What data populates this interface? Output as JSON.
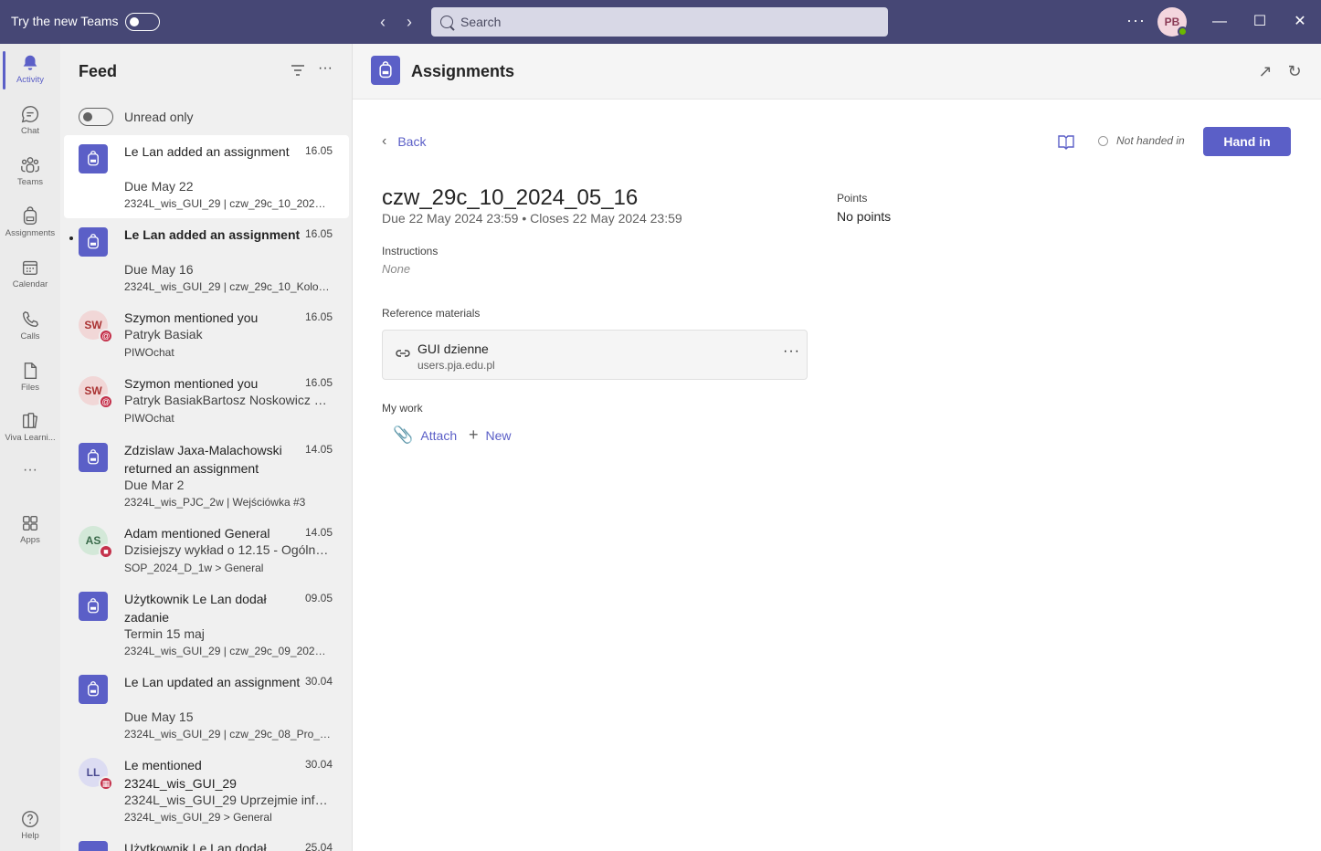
{
  "titlebar": {
    "try_new_teams": "Try the new Teams",
    "search_placeholder": "Search",
    "avatar_initials": "PB",
    "more": "···"
  },
  "rail": {
    "items": [
      {
        "label": "Activity",
        "icon": "bell-icon"
      },
      {
        "label": "Chat",
        "icon": "chat-icon"
      },
      {
        "label": "Teams",
        "icon": "teams-icon"
      },
      {
        "label": "Assignments",
        "icon": "backpack-icon"
      },
      {
        "label": "Calendar",
        "icon": "calendar-icon"
      },
      {
        "label": "Calls",
        "icon": "phone-icon"
      },
      {
        "label": "Files",
        "icon": "file-icon"
      },
      {
        "label": "Viva Learni...",
        "icon": "books-icon"
      },
      {
        "label": "Apps",
        "icon": "apps-icon"
      },
      {
        "label": "Help",
        "icon": "help-icon"
      }
    ],
    "more": "···"
  },
  "feed": {
    "title": "Feed",
    "unread_only": "Unread only",
    "items": [
      {
        "title": "Le Lan added an assignment",
        "date": "16.05",
        "sub": "Due May 22",
        "meta": "2324L_wis_GUI_29 | czw_29c_10_2024_05..."
      },
      {
        "title": "Le Lan added an assignment",
        "date": "16.05",
        "sub": "Due May 16",
        "meta": "2324L_wis_GUI_29 | czw_29c_10_Kolokwi..."
      },
      {
        "title": "Szymon mentioned you",
        "date": "16.05",
        "sub": "Patryk Basiak",
        "meta": "PIWOchat",
        "initials": "SW"
      },
      {
        "title": "Szymon mentioned you",
        "date": "16.05",
        "sub": "Patryk BasiakBartosz Noskowicz m...",
        "meta": "PIWOchat",
        "initials": "SW"
      },
      {
        "title": "Zdzislaw Jaxa-Malachowski returned an assignment",
        "date": "14.05",
        "sub": "Due Mar 2",
        "meta": "2324L_wis_PJC_2w | Wejściówka #3"
      },
      {
        "title": "Adam mentioned General",
        "date": "14.05",
        "sub": "Dzisiejszy wykład o 12.15 - Ogólne...",
        "meta": "SOP_2024_D_1w > General",
        "initials": "AS"
      },
      {
        "title": "Użytkownik Le Lan dodał zadanie",
        "date": "09.05",
        "sub": "Termin 15 maj",
        "meta": "2324L_wis_GUI_29 | czw_29c_09_2024_05..."
      },
      {
        "title": "Le Lan updated an assignment",
        "date": "30.04",
        "sub": "Due May 15",
        "meta": "2324L_wis_GUI_29 | czw_29c_08_Pro_202..."
      },
      {
        "title": "Le mentioned 2324L_wis_GUI_29",
        "date": "30.04",
        "sub": "2324L_wis_GUI_29 Uprzejmie infor...",
        "meta": "2324L_wis_GUI_29 > General",
        "initials": "LL"
      },
      {
        "title": "Użytkownik Le Lan dodał",
        "date": "25.04"
      }
    ]
  },
  "main": {
    "title": "Assignments",
    "back": "Back",
    "status": "Not handed in",
    "hand_in": "Hand in",
    "assignment_title": "czw_29c_10_2024_05_16",
    "due_text": "Due 22 May 2024 23:59 • Closes 22 May 2024 23:59",
    "points_label": "Points",
    "points_value": "No points",
    "instructions_label": "Instructions",
    "instructions_value": "None",
    "reference_label": "Reference materials",
    "reference": {
      "title": "GUI dzienne",
      "url": "users.pja.edu.pl"
    },
    "my_work_label": "My work",
    "attach": "Attach",
    "new": "New"
  },
  "colors": {
    "accent": "#5b5fc7",
    "titlebar": "#464775"
  }
}
